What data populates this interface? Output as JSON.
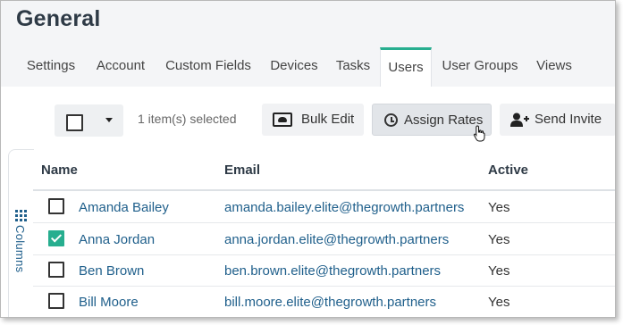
{
  "page": {
    "title": "General"
  },
  "tabs": [
    {
      "label": "Settings"
    },
    {
      "label": "Account"
    },
    {
      "label": "Custom Fields"
    },
    {
      "label": "Devices"
    },
    {
      "label": "Tasks"
    },
    {
      "label": "Users",
      "active": true
    },
    {
      "label": "User Groups"
    },
    {
      "label": "Views"
    }
  ],
  "toolbar": {
    "selection_text": "1 item(s) selected",
    "bulk_edit": "Bulk Edit",
    "assign_rates": "Assign Rates",
    "send_invite": "Send Invite"
  },
  "sidebar": {
    "columns_label": "Columns"
  },
  "table": {
    "headers": {
      "name": "Name",
      "email": "Email",
      "active": "Active"
    },
    "rows": [
      {
        "name": "Amanda Bailey",
        "email": "amanda.bailey.elite@thegrowth.partners",
        "active": "Yes",
        "checked": false
      },
      {
        "name": "Anna Jordan",
        "email": "anna.jordan.elite@thegrowth.partners",
        "active": "Yes",
        "checked": true
      },
      {
        "name": "Ben Brown",
        "email": "ben.brown.elite@thegrowth.partners",
        "active": "Yes",
        "checked": false
      },
      {
        "name": "Bill Moore",
        "email": "bill.moore.elite@thegrowth.partners",
        "active": "Yes",
        "checked": false
      }
    ]
  },
  "colors": {
    "accent": "#27ae8f",
    "link": "#1f5f8b",
    "header_bg": "#f4f5f7"
  }
}
